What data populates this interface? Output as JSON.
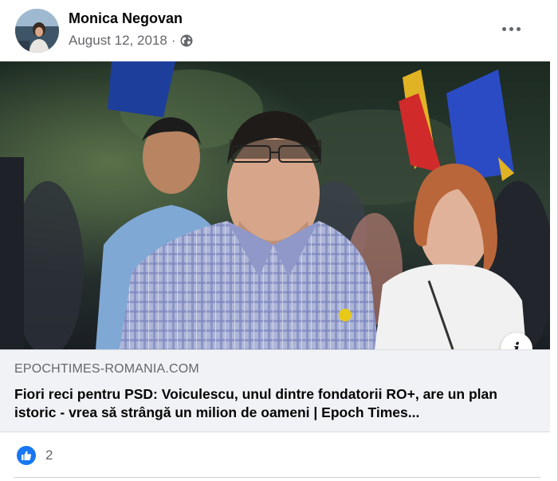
{
  "post": {
    "author": "Monica Negovan",
    "date": "August 12, 2018",
    "separator": "·",
    "audience_icon": "globe-icon",
    "more_icon": "more-options-icon"
  },
  "link_preview": {
    "domain": "EPOCHTIMES-ROMANIA.COM",
    "headline": "Fiori reci pentru PSD: Voiculescu, unul dintre fondatorii RO+, are un plan istoric - vrea să strângă un milion de oameni | Epoch Times...",
    "info_icon": "info-icon",
    "info_glyph": "i"
  },
  "reactions": {
    "type": "like",
    "count": "2"
  },
  "colors": {
    "like_blue": "#1877f2",
    "secondary_text": "#65676b",
    "link_bg": "#f0f2f5"
  }
}
